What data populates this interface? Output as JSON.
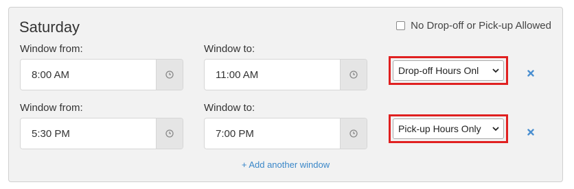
{
  "day": {
    "title": "Saturday"
  },
  "no_dropoff": {
    "label": "No Drop-off or Pick-up Allowed",
    "checked": false
  },
  "windows": [
    {
      "from_label": "Window from:",
      "from_value": "8:00 AM",
      "to_label": "Window to:",
      "to_value": "11:00 AM",
      "type": "Drop-off Hours Onl"
    },
    {
      "from_label": "Window from:",
      "from_value": "5:30 PM",
      "to_label": "Window to:",
      "to_value": "7:00 PM",
      "type": "Pick-up Hours Only"
    }
  ],
  "add_window": {
    "label": "+ Add another window"
  },
  "icons": {
    "clock": "clock-icon",
    "remove": "close-icon",
    "dropdown": "chevron-down-icon"
  },
  "colors": {
    "accent": "#3a87c8",
    "highlight": "#e02020",
    "remove": "#4a8fd0"
  }
}
